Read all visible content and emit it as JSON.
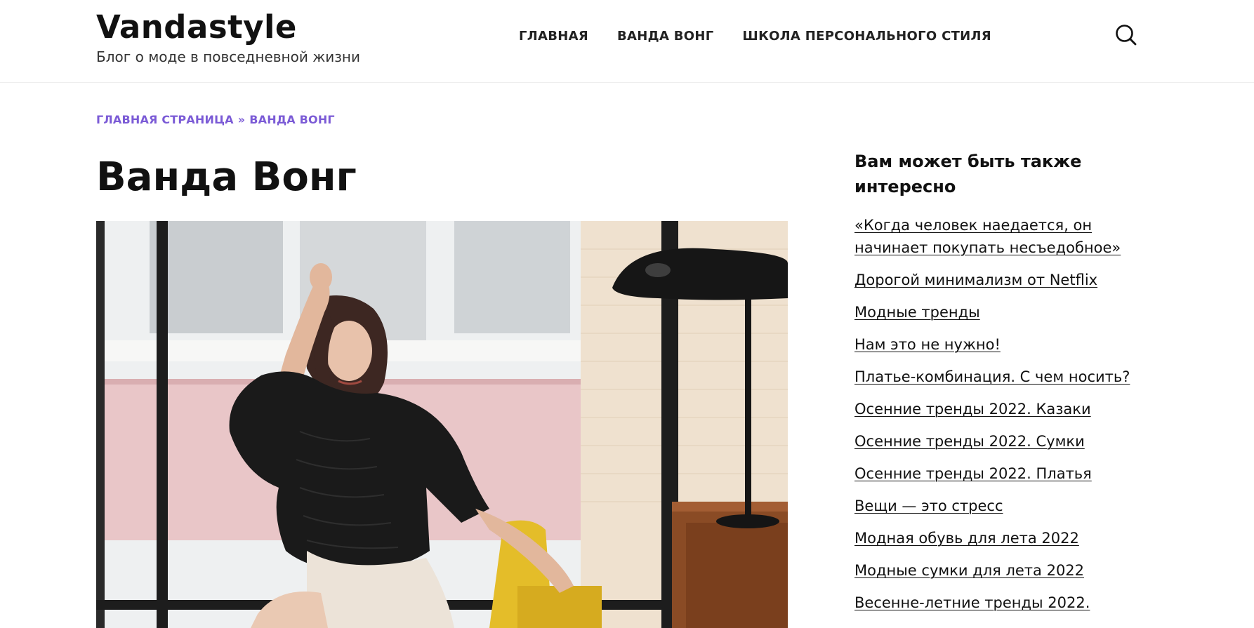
{
  "header": {
    "site_title": "Vandastyle",
    "tagline": "Блог о моде в повседневной жизни",
    "nav": [
      {
        "label": "ГЛАВНАЯ"
      },
      {
        "label": "ВАНДА ВОНГ"
      },
      {
        "label": "ШКОЛА ПЕРСОНАЛЬНОГО СТИЛЯ"
      }
    ],
    "search_icon": "search-icon"
  },
  "breadcrumb": {
    "home": "ГЛАВНАЯ СТРАНИЦА",
    "separator": "»",
    "current": "ВАНДА ВОНГ"
  },
  "article": {
    "title": "Ванда Вонг"
  },
  "sidebar": {
    "title": "Вам может быть также интересно",
    "items": [
      {
        "label": "«Когда человек наедается, он начинает покупать несъедобное»"
      },
      {
        "label": "Дорогой минимализм от Netflix"
      },
      {
        "label": "Модные тренды"
      },
      {
        "label": "Нам это не нужно!"
      },
      {
        "label": "Платье-комбинация. С чем носить?"
      },
      {
        "label": "Осенние тренды 2022. Казаки"
      },
      {
        "label": "Осенние тренды 2022. Сумки"
      },
      {
        "label": "Осенние тренды 2022. Платья"
      },
      {
        "label": "Вещи — это стресс"
      },
      {
        "label": "Модная обувь для лета 2022"
      },
      {
        "label": "Модные сумки для лета 2022"
      },
      {
        "label": "Весенне-летние тренды 2022."
      }
    ]
  },
  "colors": {
    "accent": "#7b5bd6",
    "text": "#111111",
    "background": "#ffffff"
  }
}
